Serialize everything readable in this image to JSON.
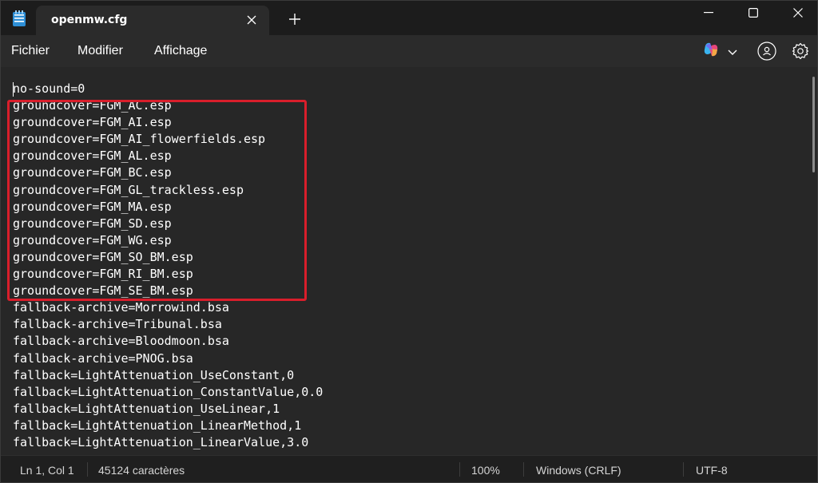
{
  "titlebar": {
    "tab_title": "openmw.cfg",
    "icons": [
      "notepad-icon",
      "close-icon",
      "plus-icon",
      "minimize-icon",
      "maximize-icon",
      "close-window-icon"
    ]
  },
  "menubar": {
    "file": "Fichier",
    "edit": "Modifier",
    "view": "Affichage",
    "icons": [
      "copilot-icon",
      "chevron-down-icon",
      "account-icon",
      "gear-icon"
    ]
  },
  "editor": {
    "lines": [
      "no-sound=0",
      "groundcover=FGM_AC.esp",
      "groundcover=FGM_AI.esp",
      "groundcover=FGM_AI_flowerfields.esp",
      "groundcover=FGM_AL.esp",
      "groundcover=FGM_BC.esp",
      "groundcover=FGM_GL_trackless.esp",
      "groundcover=FGM_MA.esp",
      "groundcover=FGM_SD.esp",
      "groundcover=FGM_WG.esp",
      "groundcover=FGM_SO_BM.esp",
      "groundcover=FGM_RI_BM.esp",
      "groundcover=FGM_SE_BM.esp",
      "fallback-archive=Morrowind.bsa",
      "fallback-archive=Tribunal.bsa",
      "fallback-archive=Bloodmoon.bsa",
      "fallback-archive=PNOG.bsa",
      "fallback=LightAttenuation_UseConstant,0",
      "fallback=LightAttenuation_ConstantValue,0.0",
      "fallback=LightAttenuation_UseLinear,1",
      "fallback=LightAttenuation_LinearMethod,1",
      "fallback=LightAttenuation_LinearValue,3.0"
    ],
    "highlight_color": "#d91e2b"
  },
  "statusbar": {
    "position": "Ln 1, Col 1",
    "characters": "45124 caractères",
    "zoom": "100%",
    "line_ending": "Windows (CRLF)",
    "encoding": "UTF-8"
  }
}
